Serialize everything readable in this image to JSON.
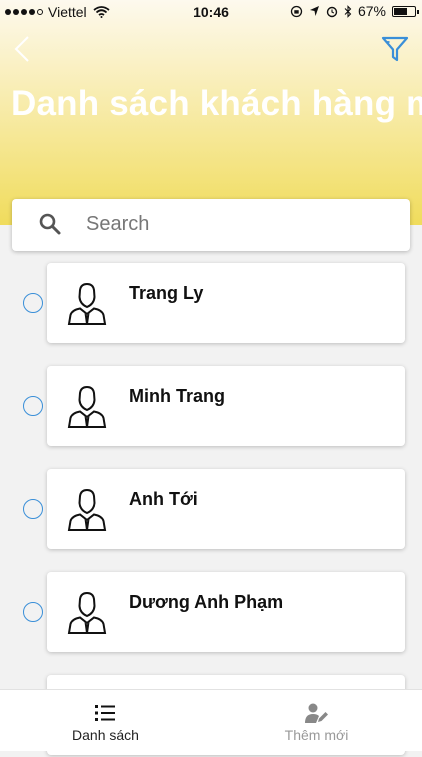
{
  "status_bar": {
    "carrier": "Viettel",
    "time": "10:46",
    "battery": "67%",
    "battery_fraction": 0.67
  },
  "header": {
    "title": "Danh sách khách hàng mới",
    "back_icon": "chevron-left-icon",
    "filter_icon": "filter-funnel-icon"
  },
  "search": {
    "placeholder": "Search",
    "value": ""
  },
  "customers": [
    {
      "name": "Trang Ly"
    },
    {
      "name": "Minh Trang"
    },
    {
      "name": "Anh Tới"
    },
    {
      "name": "Dương Anh Phạm"
    },
    {
      "name": ""
    }
  ],
  "tabs": [
    {
      "label": "Danh sách",
      "icon": "list-icon",
      "active": true
    },
    {
      "label": "Thêm mới",
      "icon": "add-user-icon",
      "active": false
    }
  ],
  "colors": {
    "accent": "#3a8fd8",
    "header_yellow": "#f0dc5c",
    "title_text": "#ffffff"
  }
}
